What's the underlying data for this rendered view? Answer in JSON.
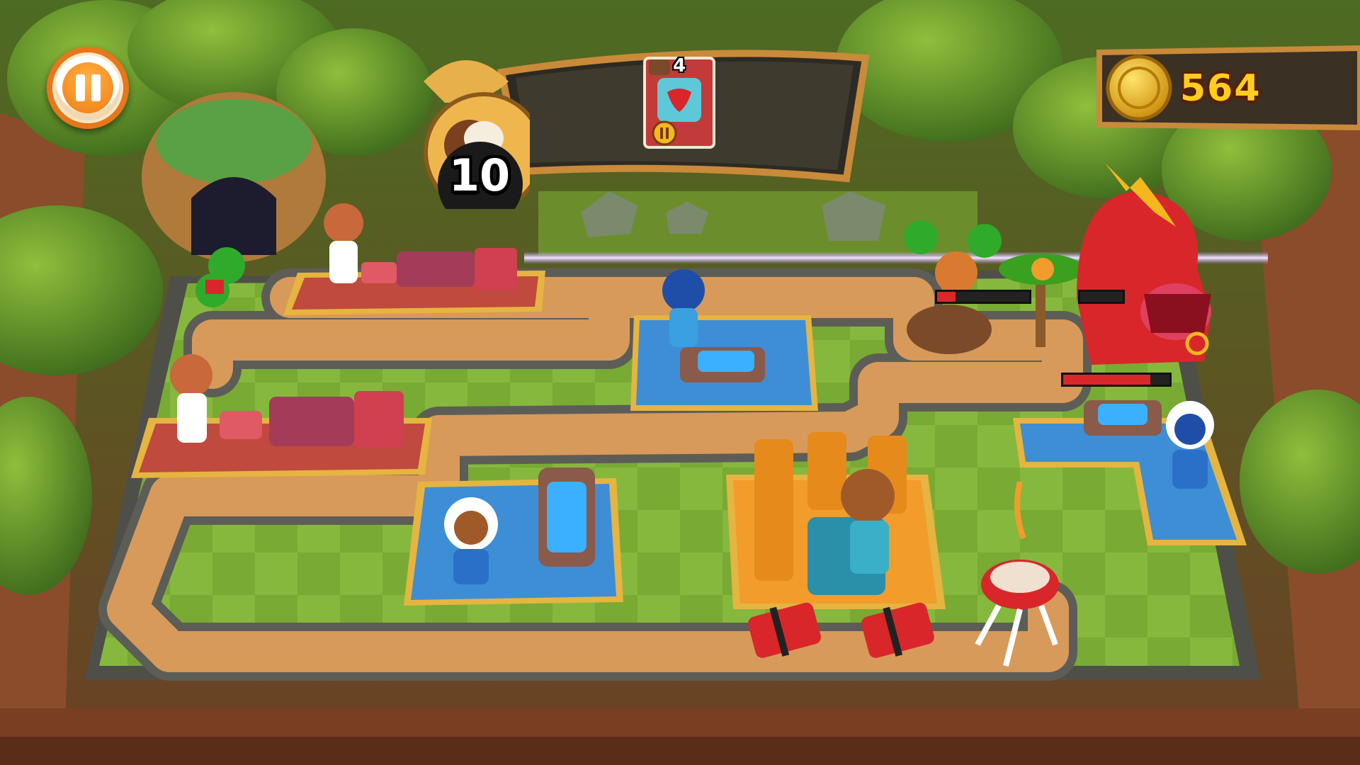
{
  "hud": {
    "pause_icon": "pause-icon",
    "coconut_count": "10",
    "coin_count": "564",
    "card": {
      "count": "4",
      "icon": "chili-card-icon"
    }
  },
  "colors": {
    "accent_orange": "#f07b12",
    "coin_gold": "#ffce1c",
    "panel_brown": "#6b3a17",
    "grass": "#7fb13a",
    "path": "#d79a5a",
    "stone": "#6a6a66",
    "health_red": "#d9282a"
  },
  "enemies": [
    {
      "name": "red-dinosaur-boss",
      "health_fraction": 0.82
    },
    {
      "name": "orange-monkey-enemy",
      "health_fraction": 0.2
    },
    {
      "name": "green-parrot-enemy",
      "health_fraction": 1.0
    }
  ]
}
